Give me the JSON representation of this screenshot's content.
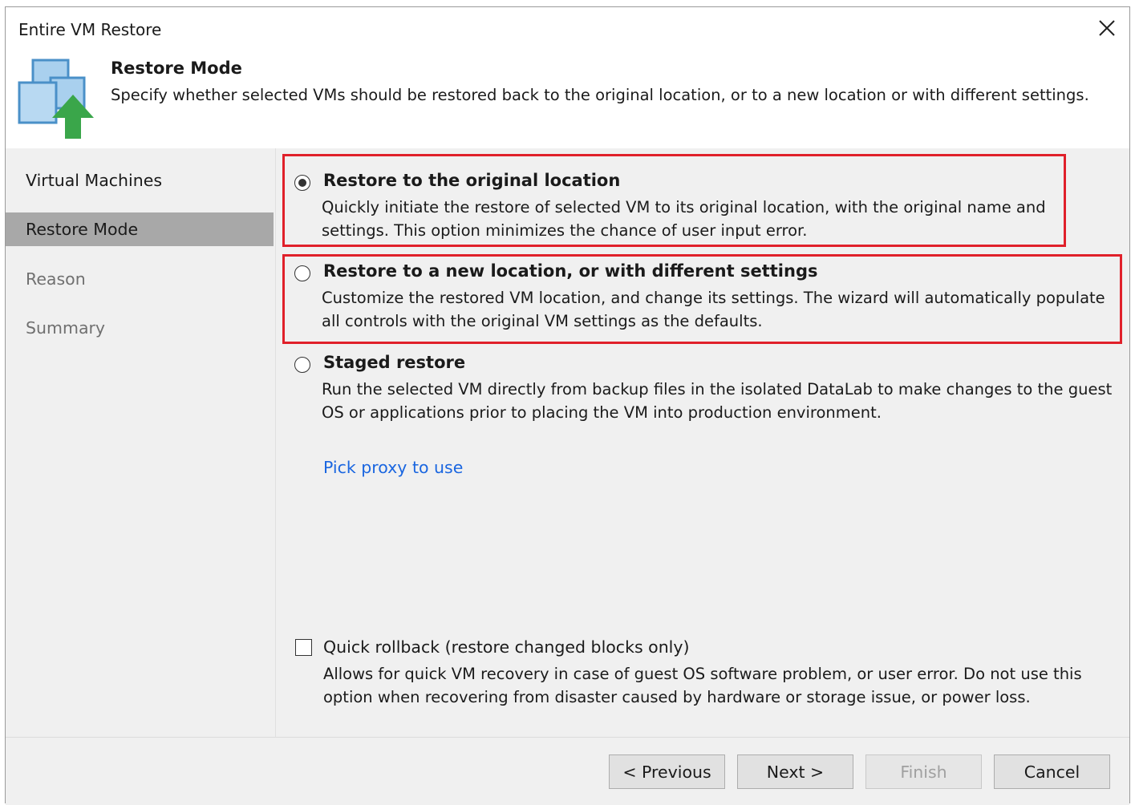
{
  "window": {
    "title": "Entire VM Restore"
  },
  "header": {
    "title": "Restore Mode",
    "description": "Specify whether selected VMs should be restored back to the original location, or to a new location or with different settings.",
    "icon": "vm-restore-icon"
  },
  "sidebar": {
    "items": [
      {
        "label": "Virtual Machines",
        "state": "normal"
      },
      {
        "label": "Restore Mode",
        "state": "active"
      },
      {
        "label": "Reason",
        "state": "disabled"
      },
      {
        "label": "Summary",
        "state": "disabled"
      }
    ]
  },
  "options": [
    {
      "title": "Restore to the original location",
      "description": "Quickly initiate the restore of selected VM to its original location, with the original name and settings. This option minimizes the chance of user input error.",
      "checked": true
    },
    {
      "title": "Restore to a new location, or with different settings",
      "description": "Customize the restored VM location, and change its settings. The wizard will automatically populate all controls with the original VM settings as the defaults.",
      "checked": false
    },
    {
      "title": "Staged restore",
      "description": "Run the selected VM directly from backup files in the isolated DataLab to make changes to the guest OS or applications prior to placing the VM into production environment.",
      "checked": false
    }
  ],
  "pick_proxy_link": "Pick proxy to use",
  "quick_rollback": {
    "label": "Quick rollback (restore changed blocks only)",
    "description": "Allows for quick VM recovery in case of guest OS software problem, or user error. Do not use this option when recovering from disaster caused by hardware or storage issue, or power loss.",
    "checked": false
  },
  "buttons": {
    "previous": "< Previous",
    "next": "Next >",
    "finish": "Finish",
    "cancel": "Cancel"
  },
  "colors": {
    "highlight": "#e0202a",
    "link": "#1a66e0",
    "active_nav": "#a8a8a8",
    "panel_bg": "#f0f0f0"
  }
}
